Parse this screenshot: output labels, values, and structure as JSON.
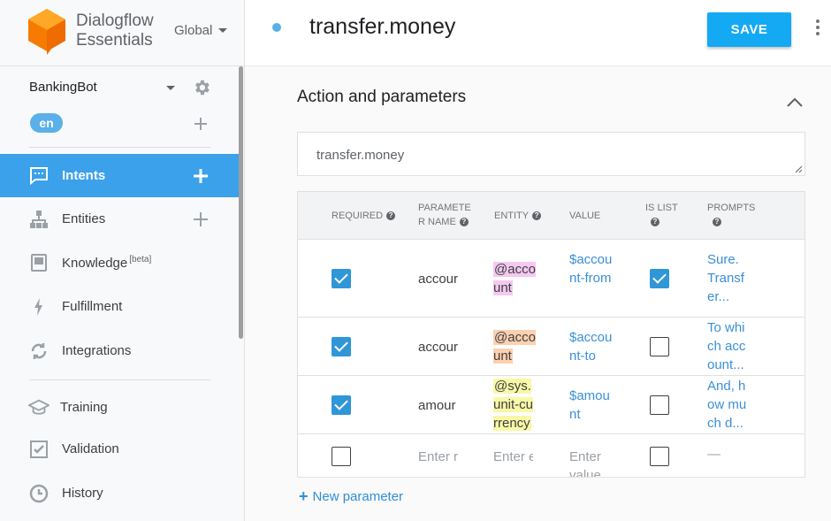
{
  "app": {
    "brand_line1": "Dialogflow",
    "brand_line2": "Essentials",
    "region": "Global"
  },
  "agent": {
    "name": "BankingBot",
    "language": "en"
  },
  "sidebar": {
    "items": [
      {
        "label": "Intents",
        "icon": "chat-bubble-icon",
        "active": true,
        "has_add": true
      },
      {
        "label": "Entities",
        "icon": "hierarchy-icon",
        "active": false,
        "has_add": true
      },
      {
        "label": "Knowledge",
        "badge": "[beta]",
        "icon": "book-icon",
        "active": false
      },
      {
        "label": "Fulfillment",
        "icon": "lightning-icon",
        "active": false
      },
      {
        "label": "Integrations",
        "icon": "sync-icon",
        "active": false
      },
      {
        "label": "Training",
        "icon": "graduation-cap-icon",
        "active": false
      },
      {
        "label": "Validation",
        "icon": "checkbox-icon",
        "active": false
      },
      {
        "label": "History",
        "icon": "clock-icon",
        "active": false
      }
    ]
  },
  "header": {
    "intent_name": "transfer.money",
    "save_label": "SAVE"
  },
  "section": {
    "title": "Action and parameters",
    "action_value": "transfer.money"
  },
  "table": {
    "headers": {
      "required": "REQUIRED",
      "param_name_1": "PARAMETE",
      "param_name_2": "R NAME",
      "entity": "ENTITY",
      "value": "VALUE",
      "is_list": "IS LIST",
      "prompts": "PROMPTS"
    },
    "rows": [
      {
        "required": true,
        "name": "accour",
        "entity": "@account",
        "value": "$account-from",
        "is_list": true,
        "prompt": "Sure. Transfer..."
      },
      {
        "required": true,
        "name": "accour",
        "entity": "@account",
        "value": "$account-to",
        "is_list": false,
        "prompt": "To which account..."
      },
      {
        "required": true,
        "name": "amour",
        "entity": "@sys.unit-currency",
        "value": "$amount",
        "is_list": false,
        "prompt": "And, how much d..."
      }
    ],
    "empty_row": {
      "name_placeholder": "Enter r",
      "entity_placeholder": "Enter e",
      "value_placeholder": "Enter value",
      "prompt_placeholder": "—"
    }
  },
  "new_parameter_label": "New parameter",
  "colors": {
    "accent": "#3aa1ea",
    "save_button": "#14a9f3",
    "link": "#3a8fd8",
    "entity_pink": "#f6c8f0",
    "entity_orange": "#fdd0b0",
    "entity_yellow": "#f9f8a6"
  }
}
